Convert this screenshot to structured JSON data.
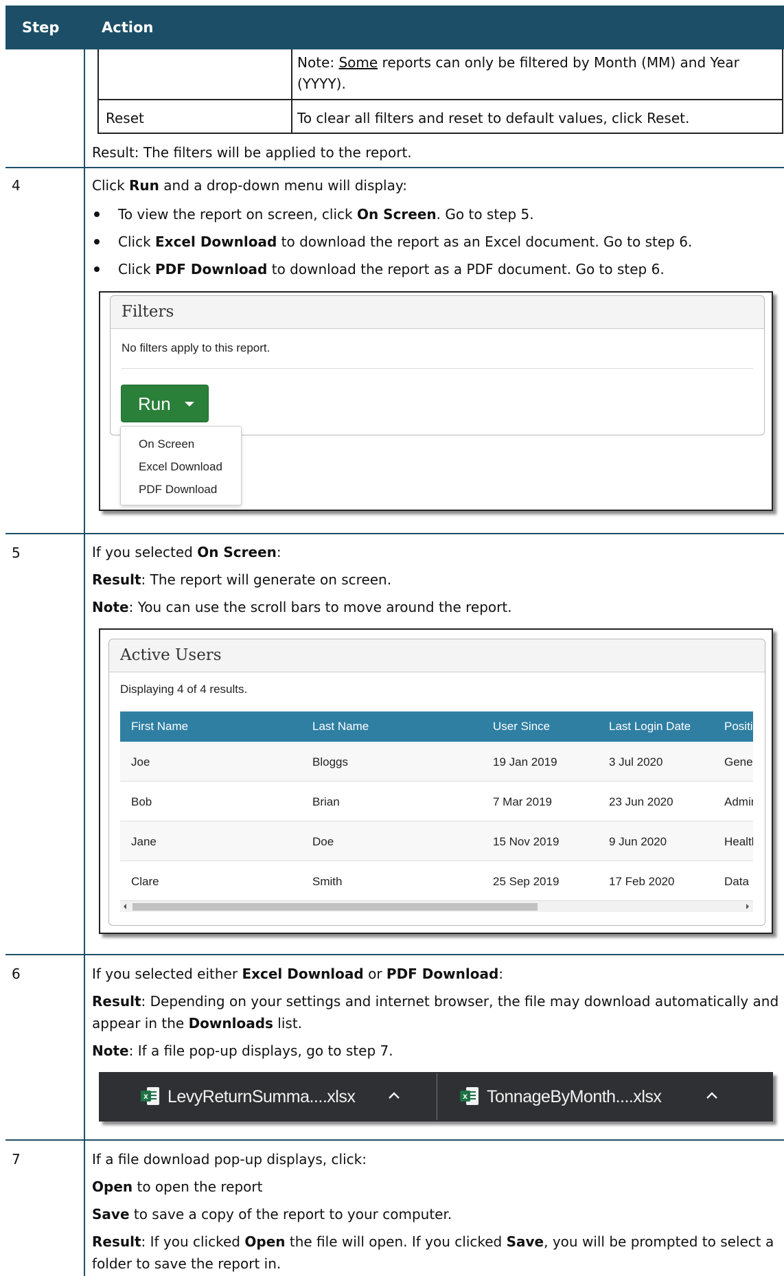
{
  "header": {
    "step": "Step",
    "action": "Action"
  },
  "top": {
    "note_prefix": "Note: ",
    "note_underlined": "Some",
    "note_rest": " reports can only be filtered by Month (MM) and Year",
    "note_line2": "(YYYY).",
    "reset_label": "Reset",
    "reset_desc": "To clear all filters and reset to default values, click Reset.",
    "result": "Result: The filters will be applied to the report."
  },
  "step4": {
    "number": "4",
    "line1_a": "Click ",
    "line1_b": "Run",
    "line1_c": " and a drop-down menu will display:",
    "b1_a": "To view the report on screen, click ",
    "b1_b": "On Screen",
    "b1_c": ". Go to step 5.",
    "b2_a": "Click ",
    "b2_b": "Excel Download",
    "b2_c": " to download the report as an Excel document. Go to step 6.",
    "b3_a": "Click ",
    "b3_b": "PDF Download",
    "b3_c": " to download the report as a PDF document. Go to step 6.",
    "filters": {
      "title": "Filters",
      "message": "No filters apply to this report.",
      "run_label": "Run",
      "menu": [
        "On Screen",
        "Excel Download",
        "PDF Download"
      ]
    }
  },
  "step5": {
    "number": "5",
    "l1_a": "If you selected ",
    "l1_b": "On Screen",
    "l1_c": ":",
    "l2_a": "Result",
    "l2_b": ": The report will generate on screen.",
    "l3_a": "Note",
    "l3_b": ": You can use the scroll bars to move around the report.",
    "report": {
      "title": "Active Users",
      "displaying": "Displaying 4 of 4 results.",
      "columns": [
        "First Name",
        "Last Name",
        "User Since",
        "Last Login Date",
        "Positi"
      ],
      "rows": [
        [
          "Joe",
          "Bloggs",
          "19 Jan 2019",
          "3 Jul 2020",
          "Gene"
        ],
        [
          "Bob",
          "Brian",
          "7 Mar 2019",
          "23 Jun 2020",
          "Admir"
        ],
        [
          "Jane",
          "Doe",
          "15 Nov 2019",
          "9 Jun 2020",
          "Healtl"
        ],
        [
          "Clare",
          "Smith",
          "25 Sep 2019",
          "17 Feb 2020",
          "Data I"
        ]
      ]
    }
  },
  "step6": {
    "number": "6",
    "l1_a": "If you selected either ",
    "l1_b": "Excel Download",
    "l1_c": " or ",
    "l1_d": "PDF Download",
    "l1_e": ":",
    "l2_a": "Result",
    "l2_b": ": Depending on your settings and internet browser, the file may download automatically and",
    "l3_a": "appear in the ",
    "l3_b": "Downloads",
    "l3_c": " list.",
    "l4_a": "Note",
    "l4_b": ": If a file pop-up displays, go to step 7.",
    "downloads": [
      "LevyReturnSumma....xlsx",
      "TonnageByMonth....xlsx"
    ]
  },
  "step7": {
    "number": "7",
    "l1": "If a file download pop-up displays, click:",
    "l2_a": "Open",
    "l2_b": " to open the report",
    "l3_a": "Save",
    "l3_b": " to save a copy of the report to your computer.",
    "l4_a": "Result",
    "l4_b": ": If you clicked ",
    "l4_c": "Open",
    "l4_d": " the file will open. If you clicked ",
    "l4_e": "Save",
    "l4_f": ", you will be prompted to select a",
    "l5": "folder to save the report in."
  },
  "colors": {
    "header_bg": "#1c4f67",
    "table_header": "#2f7fa3",
    "run_button": "#2a7f39",
    "download_bar": "#2f3033",
    "excel_green": "#1e7145"
  }
}
